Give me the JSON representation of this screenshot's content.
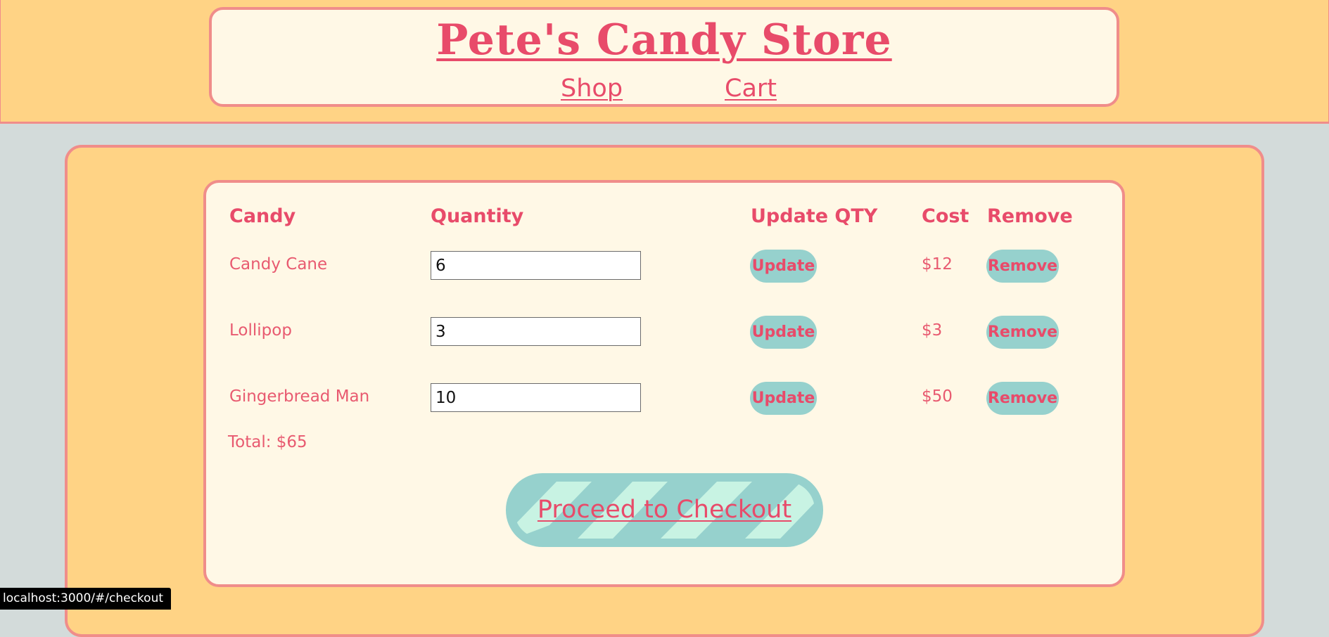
{
  "header": {
    "store_title": "Pete's Candy Store",
    "nav": {
      "shop": "Shop",
      "cart": "Cart"
    }
  },
  "cart": {
    "columns": {
      "candy": "Candy",
      "quantity": "Quantity",
      "update_qty": "Update QTY",
      "cost": "Cost",
      "remove": "Remove"
    },
    "rows": [
      {
        "candy": "Candy Cane",
        "quantity": "6",
        "update_label": "Update",
        "cost": "$12",
        "remove_label": "Remove"
      },
      {
        "candy": "Lollipop",
        "quantity": "3",
        "update_label": "Update",
        "cost": "$3",
        "remove_label": "Remove"
      },
      {
        "candy": "Gingerbread Man",
        "quantity": "10",
        "update_label": "Update",
        "cost": "$50",
        "remove_label": "Remove"
      }
    ],
    "total": "Total: $65",
    "checkout_label": "Proceed to Checkout"
  },
  "status_bar": {
    "url": "localhost:3000/#/checkout"
  },
  "colors": {
    "header_bg": "#ffd385",
    "card_bg": "#fff8e6",
    "border": "#f08d8a",
    "text_accent": "#e84b6a",
    "button_bg": "#96d1cd",
    "stripe": "#c8f3e3",
    "page_bg": "#d3dbda"
  }
}
